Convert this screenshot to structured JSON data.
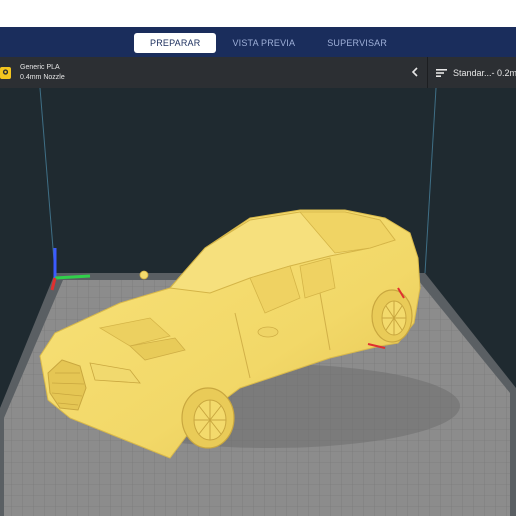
{
  "stage_menu": {
    "tabs": [
      {
        "label": "PREPARAR",
        "active": true
      },
      {
        "label": "VISTA PREVIA",
        "active": false
      },
      {
        "label": "SUPERVISAR",
        "active": false
      }
    ]
  },
  "material_panel": {
    "material": "Generic PLA",
    "nozzle": "0.4mm Nozzle",
    "icon": "extruder-icon",
    "accent_color": "#f3c51f"
  },
  "print_settings": {
    "label": "Standar...- 0.2m",
    "icon": "settings-lines-icon"
  },
  "colors": {
    "stage_bar": "#1a2d5c",
    "toolbar": "#2c2f33",
    "viewport_bg": "#1f2a30",
    "build_plate": "#8a8a8a",
    "model": "#f5dc70"
  }
}
